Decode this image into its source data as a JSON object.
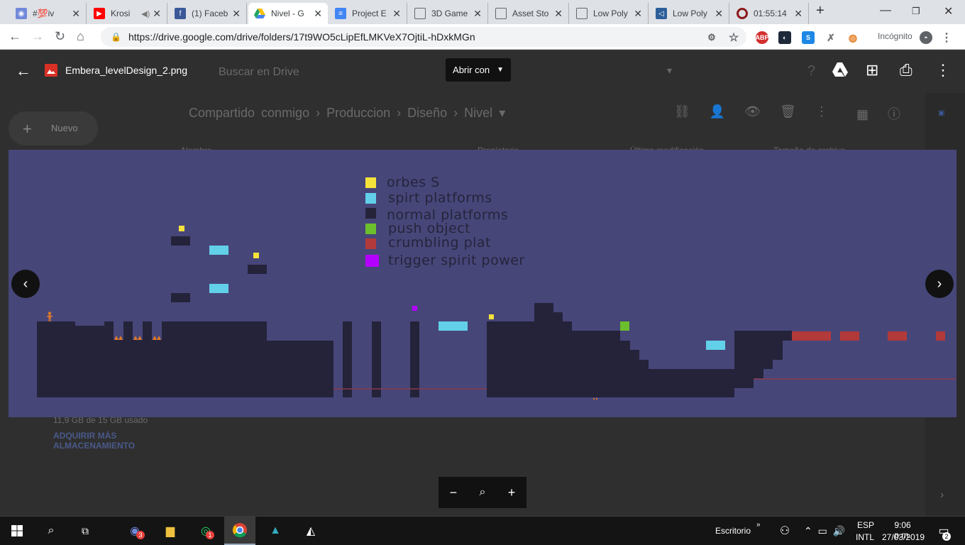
{
  "browser": {
    "tabs": [
      {
        "title": "#💯iv",
        "favicon": "discord-icon",
        "color": "#7289da"
      },
      {
        "title": "Krosi",
        "favicon": "youtube-icon",
        "color": "#ff0000"
      },
      {
        "title": "(1) Faceb",
        "favicon": "facebook-icon",
        "color": "#3b5998"
      },
      {
        "title": "Nivel - G",
        "favicon": "drive-icon",
        "color": "#1fa463",
        "active": true
      },
      {
        "title": "Project E",
        "favicon": "docs-icon",
        "color": "#4285f4"
      },
      {
        "title": "3D Game",
        "favicon": "page-icon",
        "color": "#888888"
      },
      {
        "title": "Asset Sto",
        "favicon": "page-icon",
        "color": "#888888"
      },
      {
        "title": "Low Poly",
        "favicon": "page-icon",
        "color": "#888888"
      },
      {
        "title": "Low Poly",
        "favicon": "visual-studio-icon",
        "color": "#5c2d91"
      },
      {
        "title": "01:55:14",
        "favicon": "record-icon",
        "color": "#8b1a1a"
      }
    ],
    "url": "https://drive.google.com/drive/folders/17t9WO5cLipEfLMKVeX7OjtiL-hDxkMGn",
    "incognito_label": "Incógnito"
  },
  "drive_bg": {
    "search_placeholder": "Buscar en Drive",
    "breadcrumb": [
      "Compartido conmigo",
      "Produccion",
      "Diseño",
      "Nivel"
    ],
    "new_button": "Nuevo",
    "col_name": "Nombre",
    "col_owner": "Propietario",
    "col_modified": "Última modificación",
    "col_size": "Tamaño de archivo",
    "storage": "11,9 GB de 15 GB usado",
    "buy_storage": "ADQUIRIR MÁS ALMACENAMIENTO"
  },
  "viewer": {
    "filename": "Embera_levelDesign_2.png",
    "open_with": "Abrir con"
  },
  "level_image": {
    "legend": [
      {
        "label": "orbes S",
        "color": "#f5e23a"
      },
      {
        "label": "spirt platforms",
        "color": "#62d0e8"
      },
      {
        "label": "normal platforms",
        "color": "#24233a"
      },
      {
        "label": "push object",
        "color": "#6bbf2c"
      },
      {
        "label": "crumbling plat",
        "color": "#b23a3a"
      },
      {
        "label": "trigger spirit power",
        "color": "#b400ff"
      }
    ],
    "bg_color": "#474679"
  },
  "taskbar": {
    "desktop_label": "Escritorio",
    "lang": "ESP",
    "layout": "INTL",
    "time": "9:06 p.m.",
    "date": "27/03/2019",
    "notif_count": "2",
    "discord_badge": "3",
    "whatsapp_badge": "1"
  }
}
